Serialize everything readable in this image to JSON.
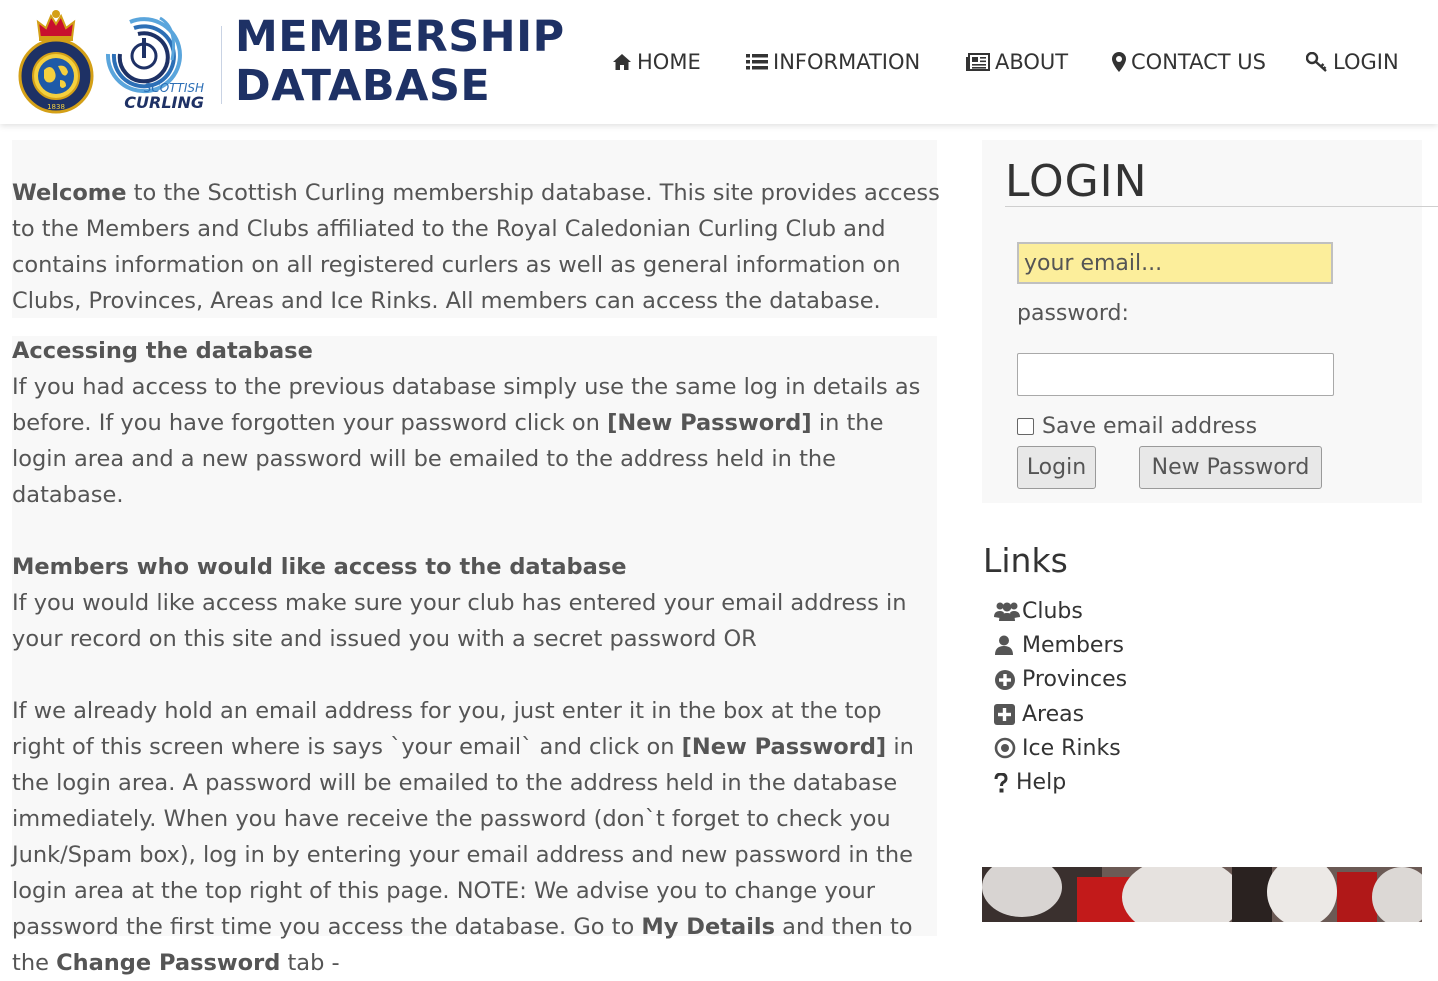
{
  "header": {
    "logo_rcc": {
      "ring_text_top": "THE ROYAL CALEDONIAN",
      "ring_text_bottom": "CURLING CLUB",
      "year": "1838"
    },
    "logo_scottish_curling": {
      "line1": "SCOTTISH",
      "line2": "CURLING"
    },
    "title_line1": "MEMBERSHIP",
    "title_line2": "DATABASE"
  },
  "nav": {
    "home": {
      "label": "HOME",
      "icon": "home-icon"
    },
    "information": {
      "label": "INFORMATION",
      "icon": "list-icon"
    },
    "about": {
      "label": "ABOUT",
      "icon": "newspaper-icon"
    },
    "contact": {
      "label": "CONTACT US",
      "icon": "map-marker-icon"
    },
    "login": {
      "label": "LOGIN",
      "icon": "key-icon"
    }
  },
  "main": {
    "welcome_bold": "Welcome",
    "welcome_text": " to the Scottish Curling membership database. This site provides access to the Members and Clubs affiliated to the Royal Caledonian Curling Club and contains information on all registered curlers as well as general information on Clubs, Provinces, Areas and Ice Rinks. All members can access the database.",
    "accessing_heading": "Accessing the database",
    "accessing_text_1": "If you had access to the previous database simply use the same log in details as before. If you have forgotten your password click on ",
    "accessing_bold": "[New Password]",
    "accessing_text_2": " in the login area and a new password will be emailed to the address held in the database.",
    "members_heading": "Members who would like access to the database",
    "members_text": "If you would like access make sure your club has entered your email address in your record on this site and issued you with a secret password OR",
    "already_text_1": "If we already hold an email address for you, just enter it in the box at the top right of this screen where is says `your email` and click on ",
    "already_bold": "[New Password]",
    "already_text_2": " in the login area. A password will be emailed to the address held in the database immediately. When you have receive the password (don`t forget to check you Junk/Spam box), log in by entering your email address and new password in the login area at the top right of this page. NOTE: We advise you to change your password the first time you access the database. Go to ",
    "my_details_bold": "My Details",
    "already_text_3": " and then to the ",
    "change_password_bold": "Change Password",
    "already_text_4": " tab - "
  },
  "login": {
    "heading": "LOGIN",
    "email_placeholder": "your email...",
    "password_label": "password:",
    "save_email_label": "Save email address",
    "save_email_checked": false,
    "login_button": "Login",
    "new_password_button": "New Password"
  },
  "links": {
    "heading": "Links",
    "items": [
      {
        "label": "Clubs",
        "icon": "users-icon"
      },
      {
        "label": "Members",
        "icon": "user-icon"
      },
      {
        "label": "Provinces",
        "icon": "plus-circle-icon"
      },
      {
        "label": "Areas",
        "icon": "plus-square-icon"
      },
      {
        "label": "Ice Rinks",
        "icon": "dot-circle-icon"
      },
      {
        "label": "Help",
        "icon": "question-icon"
      }
    ]
  },
  "colors": {
    "brand_navy": "#1e3165",
    "text": "#555555",
    "email_field_bg": "#fcee9b",
    "panel_bg": "#f8f8f8"
  }
}
